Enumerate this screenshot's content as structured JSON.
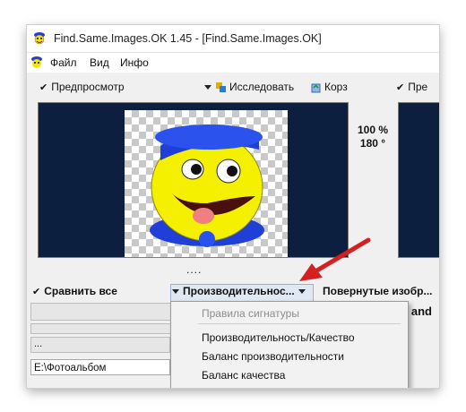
{
  "window": {
    "title": "Find.Same.Images.OK 1.45 - [Find.Same.Images.OK]"
  },
  "menu": {
    "items": [
      "Файл",
      "Вид",
      "Инфо"
    ]
  },
  "toolbar": {
    "preview_label": "Предпросмотр",
    "explore_label": "Исследовать",
    "extra_label": "Корз",
    "right_label": "Пре"
  },
  "zoom": {
    "percent": "100 %",
    "rotation": "180 °"
  },
  "divider_dots": "....",
  "controls": {
    "compare_all_label": "Сравнить все",
    "performance_label": "Производительнос...",
    "rotated_label": "Повернутые изобр..."
  },
  "dropdown": {
    "header": "Правила сигнатуры",
    "items": [
      "Производительность/Качество",
      "Баланс производительности",
      "Баланс качества"
    ]
  },
  "path_field": {
    "value": "E:\\Фотоальбом",
    "dots": "..."
  },
  "right_cut_text": "s and",
  "colors": {
    "preview_bg": "#0c1f3e",
    "arrow": "#d42020",
    "smiley_face": "#f5f000",
    "smiley_hat": "#1f3fd6"
  },
  "icons": {
    "app": "smiley-app-icon",
    "explore": "paint-icon",
    "recycle": "recycle-bin-icon",
    "check": "check-mark-icon",
    "dropdown": "dropdown-triangle-icon",
    "arrow": "red-pointer-arrow"
  }
}
